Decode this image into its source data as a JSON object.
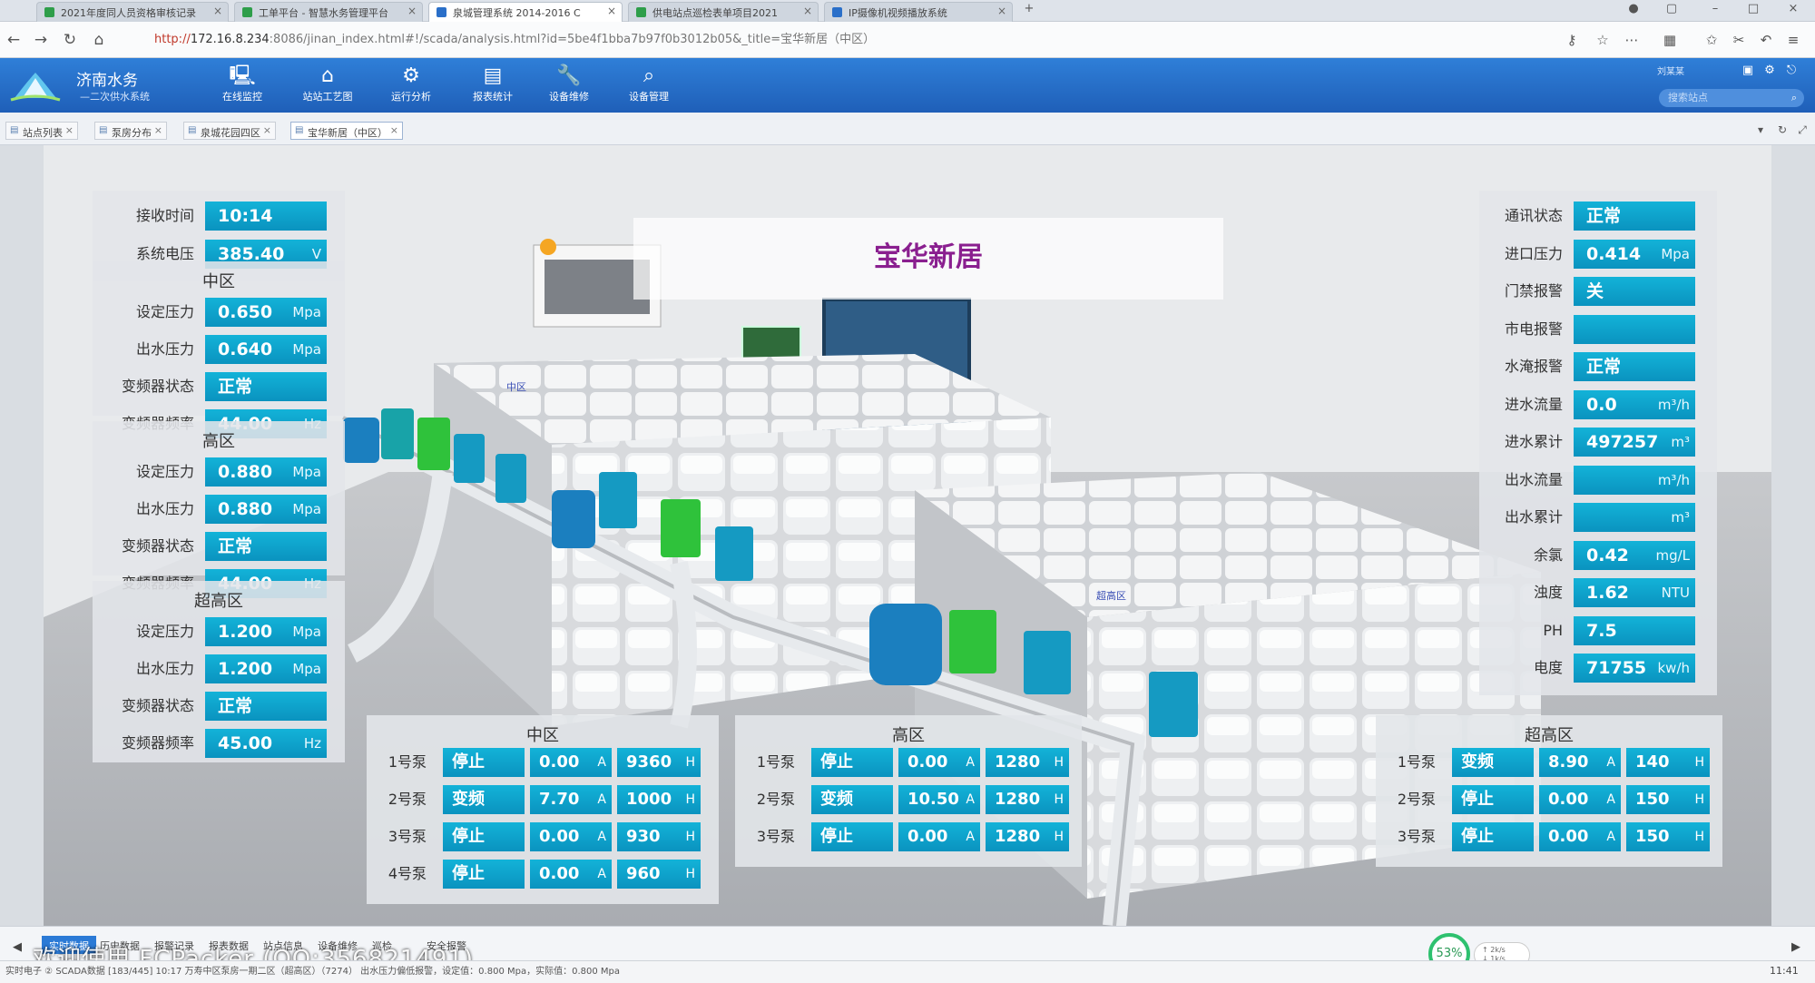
{
  "browser": {
    "tabs": [
      {
        "label": "2021年度同人员资格审核记录"
      },
      {
        "label": "工单平台 - 智慧水务管理平台"
      },
      {
        "label": "泉城管理系统 2014-2016 C"
      },
      {
        "label": "供电站点巡检表单项目2021"
      },
      {
        "label": "IP摄像机视频播放系统"
      }
    ],
    "url_scheme": "http://",
    "url_host": "172.16.8.234",
    "url_rest": ":8086/jinan_index.html#!/scada/analysis.html?id=5be4f1bba7b97f0b3012b05&_title=宝华新居（中区）"
  },
  "header": {
    "brand_name": "济南水务",
    "brand_sub": "—二次供水系统",
    "modules": [
      {
        "label": "在线监控",
        "icon": "monitor-icon"
      },
      {
        "label": "站站工艺图",
        "icon": "home-icon"
      },
      {
        "label": "运行分析",
        "icon": "gear-icon"
      },
      {
        "label": "报表统计",
        "icon": "report-icon"
      },
      {
        "label": "设备维修",
        "icon": "wrench-icon"
      },
      {
        "label": "设备管理",
        "icon": "search-icon"
      }
    ],
    "user_label": "刘某某",
    "search_placeholder": "搜索站点"
  },
  "page_tabs": [
    {
      "label": "站点列表"
    },
    {
      "label": "泵房分布"
    },
    {
      "label": "泉城花园四区"
    },
    {
      "label": "宝华新居（中区）"
    }
  ],
  "station": {
    "title": "宝华新居"
  },
  "left_top": {
    "rows": [
      {
        "label": "接收时间",
        "value": "10:14",
        "unit": ""
      },
      {
        "label": "系统电压",
        "value": "385.40",
        "unit": "V"
      }
    ]
  },
  "zones": [
    {
      "title": "中区",
      "rows": [
        {
          "label": "设定压力",
          "value": "0.650",
          "unit": "Mpa"
        },
        {
          "label": "出水压力",
          "value": "0.640",
          "unit": "Mpa"
        },
        {
          "label": "变频器状态",
          "value": "正常",
          "unit": ""
        },
        {
          "label": "变频器频率",
          "value": "44.00",
          "unit": "Hz"
        }
      ]
    },
    {
      "title": "高区",
      "rows": [
        {
          "label": "设定压力",
          "value": "0.880",
          "unit": "Mpa"
        },
        {
          "label": "出水压力",
          "value": "0.880",
          "unit": "Mpa"
        },
        {
          "label": "变频器状态",
          "value": "正常",
          "unit": ""
        },
        {
          "label": "变频器频率",
          "value": "44.00",
          "unit": "Hz"
        }
      ]
    },
    {
      "title": "超高区",
      "rows": [
        {
          "label": "设定压力",
          "value": "1.200",
          "unit": "Mpa"
        },
        {
          "label": "出水压力",
          "value": "1.200",
          "unit": "Mpa"
        },
        {
          "label": "变频器状态",
          "value": "正常",
          "unit": ""
        },
        {
          "label": "变频器频率",
          "value": "45.00",
          "unit": "Hz"
        }
      ]
    }
  ],
  "right_panel": {
    "rows": [
      {
        "label": "通讯状态",
        "value": "正常",
        "unit": ""
      },
      {
        "label": "进口压力",
        "value": "0.414",
        "unit": "Mpa"
      },
      {
        "label": "门禁报警",
        "value": "关",
        "unit": ""
      },
      {
        "label": "市电报警",
        "value": "",
        "unit": ""
      },
      {
        "label": "水淹报警",
        "value": "正常",
        "unit": ""
      },
      {
        "label": "进水流量",
        "value": "0.0",
        "unit": "m³/h"
      },
      {
        "label": "进水累计",
        "value": "497257",
        "unit": "m³"
      },
      {
        "label": "出水流量",
        "value": "",
        "unit": "m³/h"
      },
      {
        "label": "出水累计",
        "value": "",
        "unit": "m³"
      },
      {
        "label": "余氯",
        "value": "0.42",
        "unit": "mg/L"
      },
      {
        "label": "浊度",
        "value": "1.62",
        "unit": "NTU"
      },
      {
        "label": "PH",
        "value": "7.5",
        "unit": ""
      },
      {
        "label": "电度",
        "value": "71755",
        "unit": "kw/h"
      }
    ]
  },
  "pump_tables": [
    {
      "title": "中区",
      "pumps": [
        {
          "name": "1号泵",
          "state": "停止",
          "current": "0.00",
          "current_unit": "A",
          "hours": "9360",
          "hours_unit": "H"
        },
        {
          "name": "2号泵",
          "state": "变频",
          "current": "7.70",
          "current_unit": "A",
          "hours": "1000",
          "hours_unit": "H"
        },
        {
          "name": "3号泵",
          "state": "停止",
          "current": "0.00",
          "current_unit": "A",
          "hours": "930",
          "hours_unit": "H"
        },
        {
          "name": "4号泵",
          "state": "停止",
          "current": "0.00",
          "current_unit": "A",
          "hours": "960",
          "hours_unit": "H"
        }
      ]
    },
    {
      "title": "高区",
      "pumps": [
        {
          "name": "1号泵",
          "state": "停止",
          "current": "0.00",
          "current_unit": "A",
          "hours": "1280",
          "hours_unit": "H"
        },
        {
          "name": "2号泵",
          "state": "变频",
          "current": "10.50",
          "current_unit": "A",
          "hours": "1280",
          "hours_unit": "H"
        },
        {
          "name": "3号泵",
          "state": "停止",
          "current": "0.00",
          "current_unit": "A",
          "hours": "1280",
          "hours_unit": "H"
        }
      ]
    },
    {
      "title": "超高区",
      "pumps": [
        {
          "name": "1号泵",
          "state": "变频",
          "current": "8.90",
          "current_unit": "A",
          "hours": "140",
          "hours_unit": "H"
        },
        {
          "name": "2号泵",
          "state": "停止",
          "current": "0.00",
          "current_unit": "A",
          "hours": "150",
          "hours_unit": "H"
        },
        {
          "name": "3号泵",
          "state": "停止",
          "current": "0.00",
          "current_unit": "A",
          "hours": "150",
          "hours_unit": "H"
        }
      ]
    }
  ],
  "tank_labels": [
    "中区",
    "超高区"
  ],
  "bottom_tabs": [
    {
      "label": "实时数据"
    },
    {
      "label": "历史数据"
    },
    {
      "label": "报警记录"
    },
    {
      "label": "报表数据"
    },
    {
      "label": "站点信息"
    },
    {
      "label": "设备维修"
    },
    {
      "label": "巡检"
    },
    {
      "label": "安全报警"
    }
  ],
  "status": {
    "text": "实时电子 ② SCADA数据 [183/445]  10:17 万寿中区泵房一期二区（超高区）（7274） 出水压力偏低报警，设定值：0.800 Mpa，实际值：0.800 Mpa",
    "watermark": "欢迎使用 FCPacker (QQ:356821491)",
    "cpu": "53%",
    "net_up": "↑ 2k/s",
    "net_down": "↓ 1k/s",
    "clock": "11:41"
  }
}
